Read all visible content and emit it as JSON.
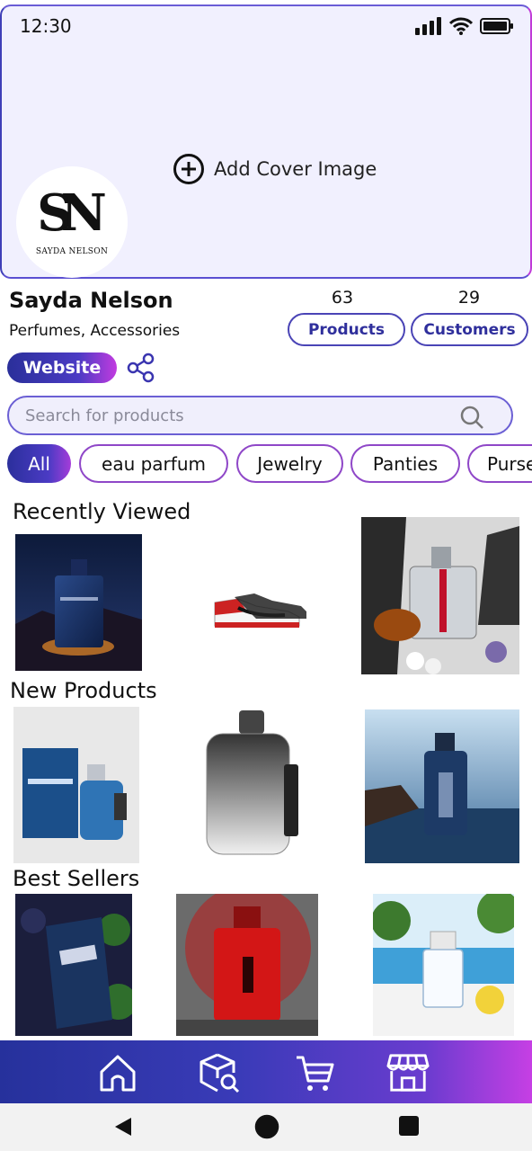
{
  "status_bar": {
    "time": "12:30",
    "icons": [
      "signal-icon",
      "wifi-icon",
      "battery-icon"
    ]
  },
  "cover": {
    "add_cover_label": "Add Cover Image"
  },
  "logo": {
    "mark": "SN",
    "text": "SAYDA NELSON"
  },
  "store": {
    "name": "Sayda Nelson",
    "categories": "Perfumes, Accessories",
    "website_label": "Website"
  },
  "stats": {
    "products": {
      "count": "63",
      "label": "Products"
    },
    "customers": {
      "count": "29",
      "label": "Customers"
    }
  },
  "search": {
    "placeholder": "Search for products"
  },
  "filters": [
    "All",
    "eau parfum",
    "Jewelry",
    "Panties",
    "Purse"
  ],
  "active_filter": "All",
  "sections": {
    "recently_viewed": {
      "title": "Recently Viewed",
      "items": [
        "dior-sauvage-image",
        "sneaker-image",
        "prada-luna-rossa-image"
      ]
    },
    "new_products": {
      "title": "New Products",
      "items": [
        "coach-blue-image",
        "coach-silver-image",
        "boss-bottled-image"
      ]
    },
    "best_sellers": {
      "title": "Best Sellers",
      "items": [
        "ysl-y-image",
        "polo-red-image",
        "dolce-gabbana-light-blue-image"
      ]
    }
  },
  "bottom_nav": [
    "home-icon",
    "product-search-icon",
    "cart-icon",
    "store-icon"
  ],
  "system_nav": [
    "back-icon",
    "home-circle-icon",
    "recents-icon"
  ],
  "colors": {
    "primary": "#2f2f9c",
    "accent": "#c23be0",
    "cover_bg": "#f1f0fe"
  }
}
